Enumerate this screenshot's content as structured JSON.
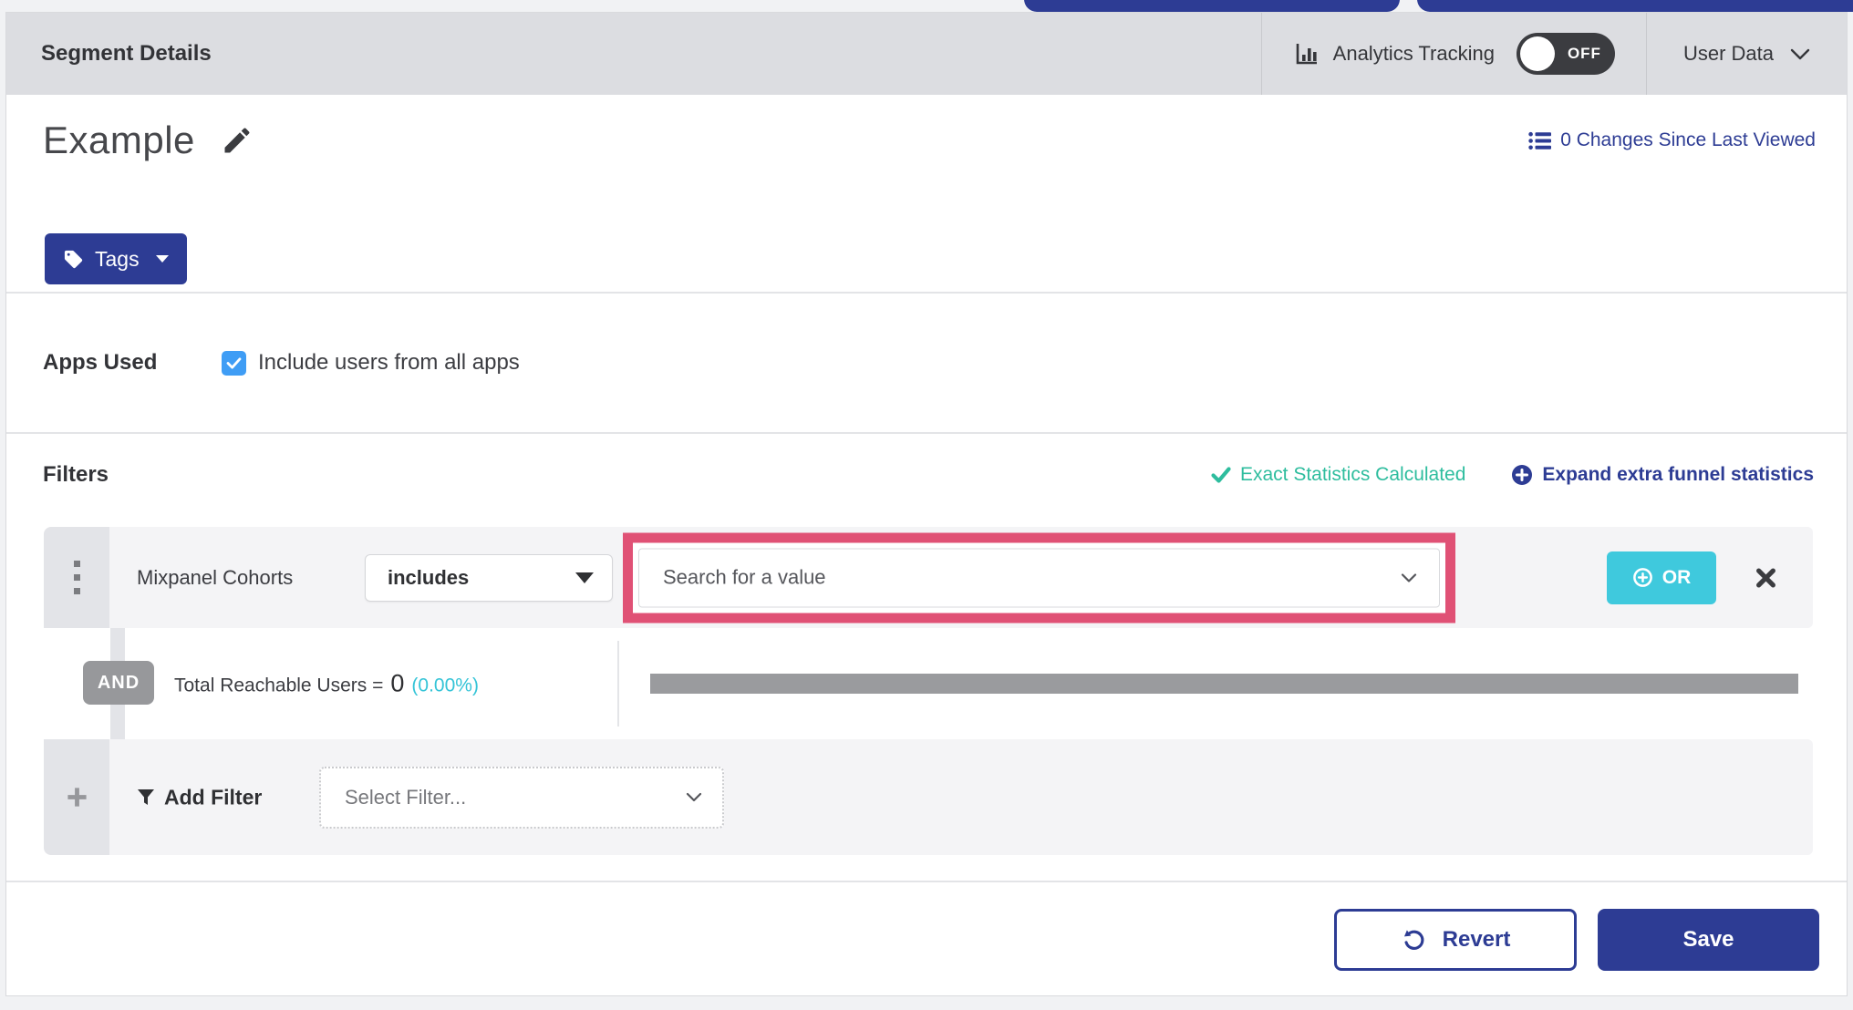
{
  "header": {
    "title": "Segment Details",
    "analytics_label": "Analytics Tracking",
    "toggle_state": "OFF",
    "user_data_label": "User Data"
  },
  "title_section": {
    "segment_name": "Example",
    "changes_link": "0 Changes Since Last Viewed",
    "tags_button": "Tags"
  },
  "apps": {
    "label": "Apps Used",
    "checkbox_label": "Include users from all apps",
    "checkbox_checked": "true"
  },
  "filters": {
    "heading": "Filters",
    "exact_stats": "Exact Statistics Calculated",
    "expand_link": "Expand extra funnel statistics",
    "row": {
      "field": "Mixpanel Cohorts",
      "operator": "includes",
      "value_placeholder": "Search for a value",
      "or_label": "OR"
    },
    "and_label": "AND",
    "reach": {
      "text": "Total Reachable Users =",
      "count": "0",
      "percent": "(0.00%)"
    },
    "add_filter": {
      "label": "Add Filter",
      "placeholder": "Select Filter..."
    }
  },
  "footer": {
    "revert_label": "Revert",
    "save_label": "Save"
  },
  "colors": {
    "primary_blue": "#2d3c94",
    "teal_or_button": "#3fc9dd",
    "green_check": "#2ebd9e",
    "cyan_percent": "#35c4d7",
    "pink_highlight": "#e05175",
    "checkbox_blue": "#3f9df5",
    "toggle_dark": "#3b3c40",
    "header_gray": "#dcdde1"
  }
}
